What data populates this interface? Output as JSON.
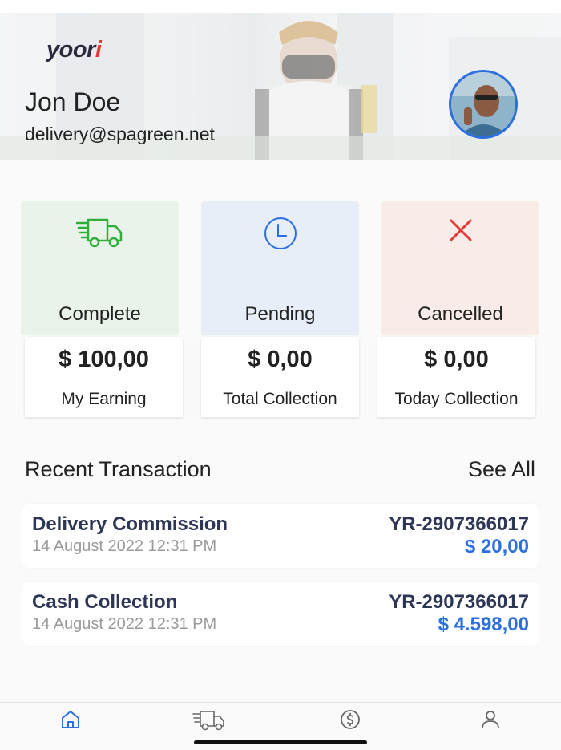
{
  "header": {
    "logo": "yoori",
    "user_name": "Jon Doe",
    "user_email": "delivery@spagreen.net"
  },
  "cards": [
    {
      "label": "Complete",
      "amount": "$ 100,00",
      "sub_label": "My Earning",
      "icon": "delivery-truck-icon",
      "bg": "#e9f3ea",
      "icon_color": "#2fae3a"
    },
    {
      "label": "Pending",
      "amount": "$ 0,00",
      "sub_label": "Total Collection",
      "icon": "clock-icon",
      "bg": "#e8eef8",
      "icon_color": "#2b6fe0"
    },
    {
      "label": "Cancelled",
      "amount": "$ 0,00",
      "sub_label": "Today Collection",
      "icon": "close-icon",
      "bg": "#f8ebe8",
      "icon_color": "#e53935"
    }
  ],
  "recent": {
    "title": "Recent Transaction",
    "see_all": "See All",
    "items": [
      {
        "title": "Delivery Commission",
        "date": "14 August 2022 12:31 PM",
        "ref": "YR-2907366017",
        "amount": "$ 20,00"
      },
      {
        "title": "Cash Collection",
        "date": "14 August 2022 12:31 PM",
        "ref": "YR-2907366017",
        "amount": "$ 4.598,00"
      }
    ]
  },
  "tabs": [
    {
      "name": "home",
      "icon": "home-icon",
      "active": true
    },
    {
      "name": "deliveries",
      "icon": "delivery-truck-icon",
      "active": false
    },
    {
      "name": "earnings",
      "icon": "dollar-icon",
      "active": false
    },
    {
      "name": "profile",
      "icon": "user-icon",
      "active": false
    }
  ],
  "colors": {
    "accent": "#2b6fe0",
    "text_dark": "#2e3656"
  }
}
